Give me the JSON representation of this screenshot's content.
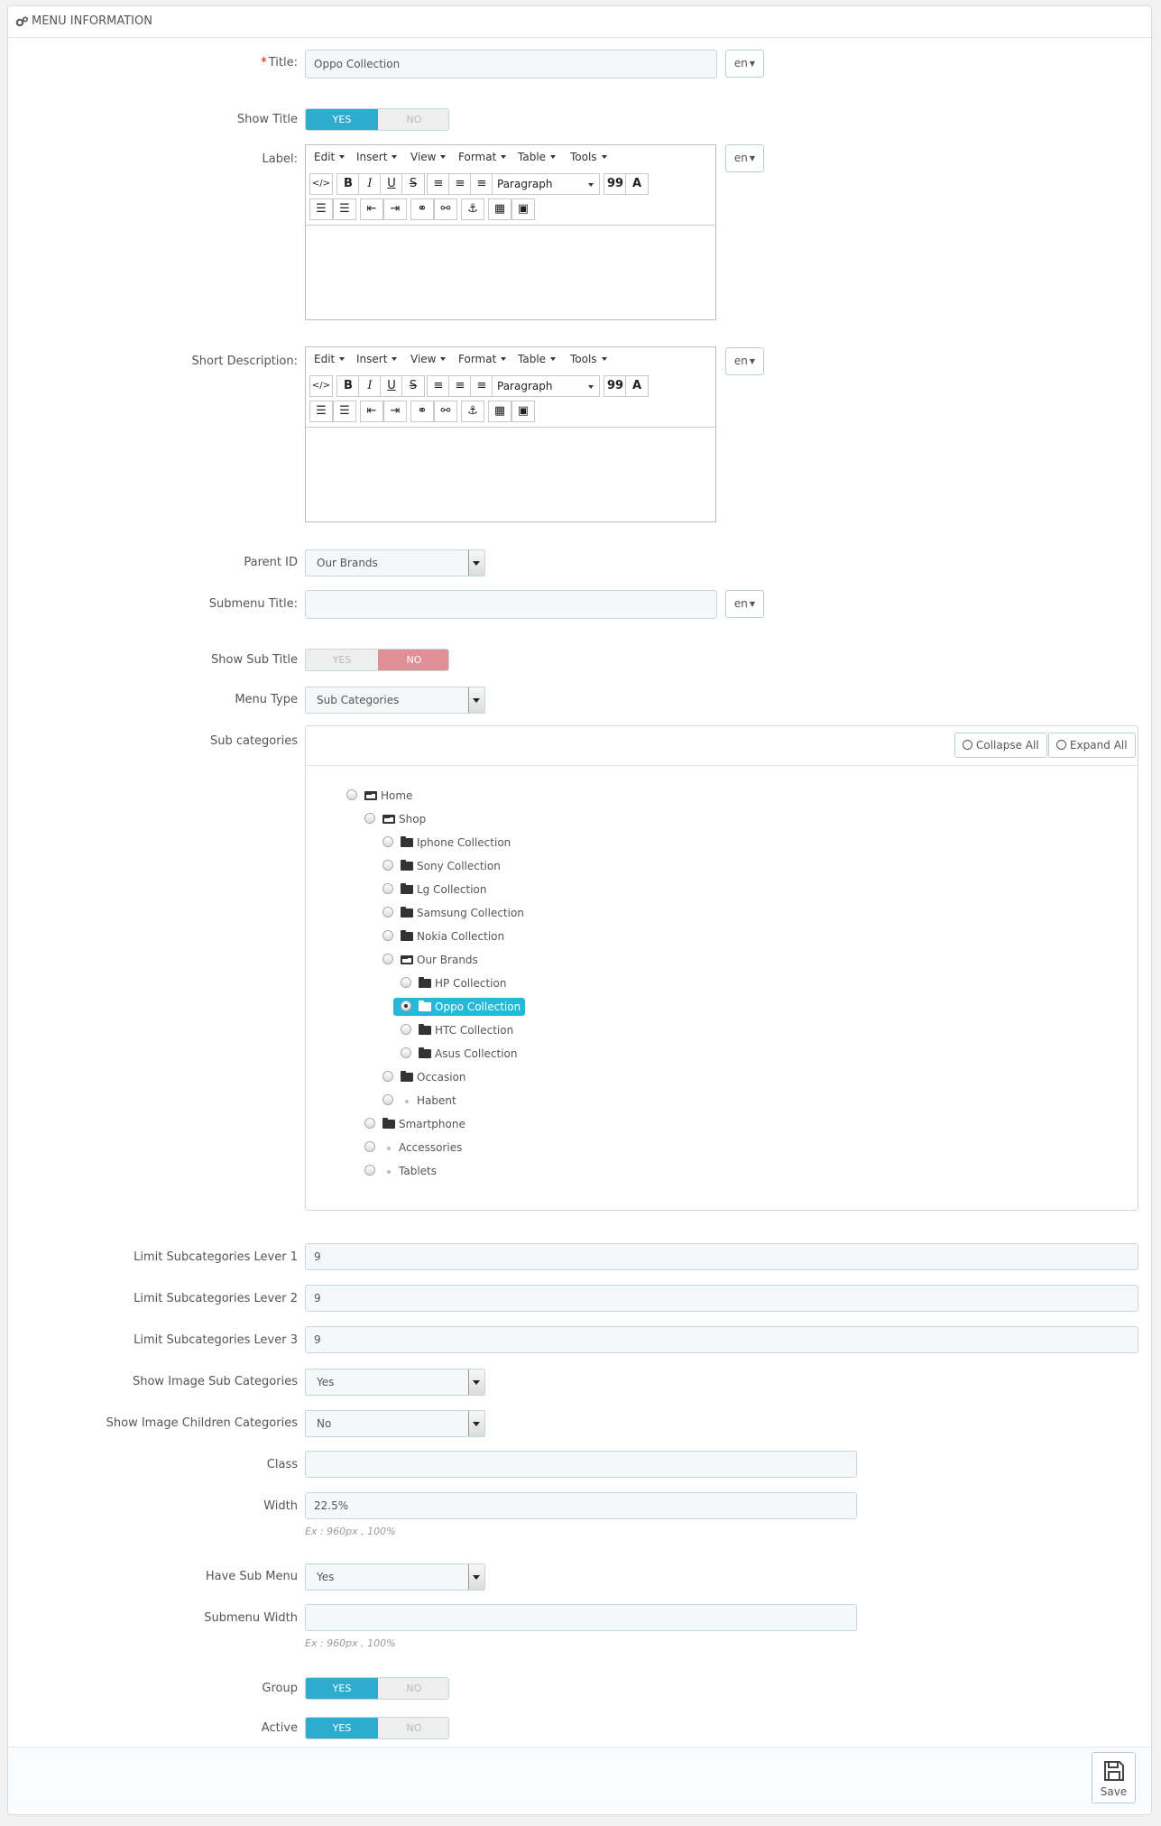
{
  "header": {
    "title": "MENU INFORMATION",
    "icon": "gears-icon"
  },
  "fields": {
    "title": {
      "label": "Title:",
      "required": "*",
      "value": "Oppo Collection",
      "lang": "en"
    },
    "show_title": {
      "label": "Show Title",
      "yes": "YES",
      "no": "NO",
      "value": "YES"
    },
    "label_field": {
      "label": "Label:",
      "lang": "en"
    },
    "short_description": {
      "label": "Short Description:",
      "lang": "en"
    },
    "parent_id": {
      "label": "Parent ID",
      "value": "Our Brands"
    },
    "submenu_title": {
      "label": "Submenu Title:",
      "value": "",
      "lang": "en"
    },
    "show_sub_title": {
      "label": "Show Sub Title",
      "yes": "YES",
      "no": "NO",
      "value": "NO"
    },
    "menu_type": {
      "label": "Menu Type",
      "value": "Sub Categories"
    },
    "sub_categories": {
      "label": "Sub categories"
    },
    "limit_1": {
      "label": "Limit Subcategories Lever 1",
      "value": "9"
    },
    "limit_2": {
      "label": "Limit Subcategories Lever 2",
      "value": "9"
    },
    "limit_3": {
      "label": "Limit Subcategories Lever 3",
      "value": "9"
    },
    "show_image_sub": {
      "label": "Show Image Sub Categories",
      "value": "Yes"
    },
    "show_image_children": {
      "label": "Show Image Children Categories",
      "value": "No"
    },
    "class_field": {
      "label": "Class",
      "value": ""
    },
    "width": {
      "label": "Width",
      "value": "22.5%",
      "help": "Ex : 960px , 100%"
    },
    "have_sub_menu": {
      "label": "Have Sub Menu",
      "value": "Yes"
    },
    "submenu_width": {
      "label": "Submenu Width",
      "value": "",
      "help": "Ex : 960px , 100%"
    },
    "group": {
      "label": "Group",
      "yes": "YES",
      "no": "NO",
      "value": "YES"
    },
    "active": {
      "label": "Active",
      "yes": "YES",
      "no": "NO",
      "value": "YES"
    }
  },
  "editor": {
    "menus": [
      "Edit",
      "Insert",
      "View",
      "Format",
      "Table",
      "Tools"
    ],
    "buttons": {
      "code": "</>",
      "bold": "B",
      "italic": "I",
      "underline": "U",
      "strike": "S",
      "paragraph": "Paragraph",
      "quote": "99",
      "text_color": "A"
    }
  },
  "tree": {
    "collapse_all": "Collapse All",
    "expand_all": "Expand All",
    "nodes": [
      {
        "name": "Home",
        "type": "folder-open",
        "selected": false
      },
      {
        "name": "Shop",
        "type": "folder-open",
        "selected": false
      },
      {
        "name": "Iphone Collection",
        "type": "folder",
        "selected": false
      },
      {
        "name": "Sony Collection",
        "type": "folder",
        "selected": false
      },
      {
        "name": "Lg Collection",
        "type": "folder",
        "selected": false
      },
      {
        "name": "Samsung Collection",
        "type": "folder",
        "selected": false
      },
      {
        "name": "Nokia Collection",
        "type": "folder",
        "selected": false
      },
      {
        "name": "Our Brands",
        "type": "folder-open",
        "selected": false
      },
      {
        "name": "HP Collection",
        "type": "folder",
        "selected": false
      },
      {
        "name": "Oppo Collection",
        "type": "folder",
        "selected": true
      },
      {
        "name": "HTC Collection",
        "type": "folder",
        "selected": false
      },
      {
        "name": "Asus Collection",
        "type": "folder",
        "selected": false
      },
      {
        "name": "Occasion",
        "type": "folder",
        "selected": false
      },
      {
        "name": "Habent",
        "type": "leaf",
        "selected": false
      },
      {
        "name": "Smartphone",
        "type": "folder",
        "selected": false
      },
      {
        "name": "Accessories",
        "type": "leaf",
        "selected": false
      },
      {
        "name": "Tablets",
        "type": "leaf",
        "selected": false
      }
    ]
  },
  "footer": {
    "save_label": "Save"
  },
  "colors": {
    "switch_on": "#2eacce",
    "switch_no_on": "#e08f95",
    "tree_highlight": "#25b9d7"
  }
}
